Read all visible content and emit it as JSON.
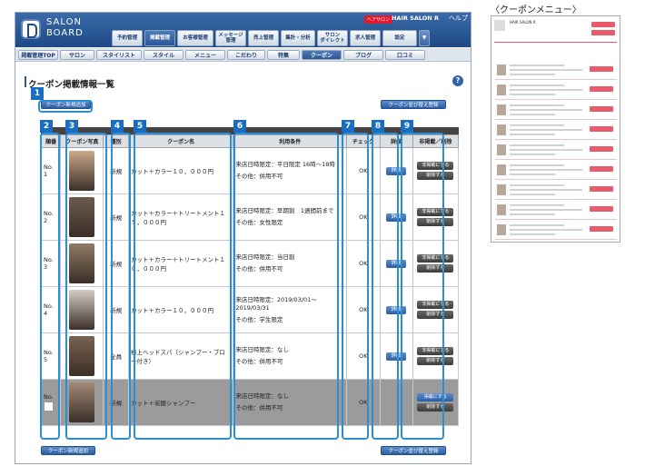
{
  "header": {
    "logo_text": "SALON\nBOARD",
    "salon_badge": "ヘアサロン",
    "salon_name": "HAIR SALON R",
    "help": "ヘルプ",
    "nav": [
      {
        "label": "予約管理",
        "w": 34
      },
      {
        "label": "掲載管理",
        "w": 34,
        "active": true
      },
      {
        "label": "お客様管理",
        "w": 40
      },
      {
        "label": "メッセージ\n管理",
        "w": 34
      },
      {
        "label": "売上管理",
        "w": 34
      },
      {
        "label": "集計・分析",
        "w": 38
      },
      {
        "label": "サロン\nダイレクト",
        "w": 34
      },
      {
        "label": "求人管理",
        "w": 34
      },
      {
        "label": "設定",
        "w": 38
      }
    ],
    "nav_more": "▼"
  },
  "subnav": [
    {
      "label": "掲載管理TOP"
    },
    {
      "label": "サロン"
    },
    {
      "label": "スタイリスト"
    },
    {
      "label": "スタイル"
    },
    {
      "label": "メニュー"
    },
    {
      "label": "こだわり"
    },
    {
      "label": "特集"
    },
    {
      "label": "クーポン",
      "active": true
    },
    {
      "label": "ブログ"
    },
    {
      "label": "口コミ"
    }
  ],
  "page": {
    "title": "クーポン掲載情報一覧",
    "help": "?",
    "add_button": "クーポン新規追加",
    "sort_button": "クーポン並び替え登録",
    "add_button_bottom": "クーポン新規追加",
    "sort_button_bottom": "クーポン並び替え登録"
  },
  "annotations": [
    "1",
    "2",
    "3",
    "4",
    "5",
    "6",
    "7",
    "8",
    "9"
  ],
  "table": {
    "headers": [
      "順番",
      "クーポン写真",
      "種別",
      "クーポン名",
      "利用条件",
      "チェック",
      "詳細",
      "非掲載／削除"
    ],
    "rows": [
      {
        "no": "No.",
        "order": "1",
        "type": "新規",
        "name": "カット＋カラー１０，０００円",
        "cond1": "来店日時限定：平日限定 16時〜18時",
        "cond2": "その他：併用不可",
        "check": "OK",
        "detail": "詳細",
        "hide": "非掲載にする",
        "del": "削除する",
        "photo": "#c9a98a"
      },
      {
        "no": "No.",
        "order": "2",
        "type": "新規",
        "name": "カット＋カラー＋トリートメント１５，０００円",
        "cond1": "来店日時限定：早期割　1週間前まで",
        "cond2": "その他：女性限定",
        "check": "OK",
        "detail": "詳細",
        "hide": "非掲載にする",
        "del": "削除する",
        "photo": "#6d5a4e"
      },
      {
        "no": "No.",
        "order": "3",
        "type": "新規",
        "name": "カット＋カラー＋トリートメント１０，０００円",
        "cond1": "来店日時限定：当日割",
        "cond2": "その他：併用不可",
        "check": "OK",
        "detail": "詳細",
        "hide": "非掲載にする",
        "del": "削除する",
        "photo": "#8f7a66"
      },
      {
        "no": "No.",
        "order": "4",
        "type": "新規",
        "name": "カット＋カラー１０，０００円",
        "cond1": "来店日時限定：2019/03/01〜2019/03/31",
        "cond2": "その他：学生限定",
        "check": "OK",
        "detail": "詳細",
        "hide": "非掲載にする",
        "del": "削除する",
        "photo": "#d7cdc5"
      },
      {
        "no": "No.",
        "order": "5",
        "type": "全員",
        "name": "極上ヘッドスパ（シャンプー・ブロー付き）",
        "cond1": "来店日時限定：なし",
        "cond2": "その他：併用不可",
        "check": "OK",
        "detail": "詳細",
        "hide": "非掲載にする",
        "del": "削除する",
        "photo": "#7a6350"
      },
      {
        "no": "No.",
        "order": "",
        "type": "新規",
        "name": "カット＋炭酸シャンプー",
        "cond1": "来店日時限定：なし",
        "cond2": "その他：併用不可",
        "check": "OK",
        "detail": "",
        "hide": "掲載にする",
        "del": "削除する",
        "photo": "#a08a78",
        "grey": true
      }
    ]
  },
  "side": {
    "title": "〈クーポンメニュー〉",
    "salon_name": "HAIR SALON R"
  },
  "colors": {
    "header": "#2b5796",
    "accent": "#2c8fd3",
    "badge": "#1a6ec2"
  }
}
